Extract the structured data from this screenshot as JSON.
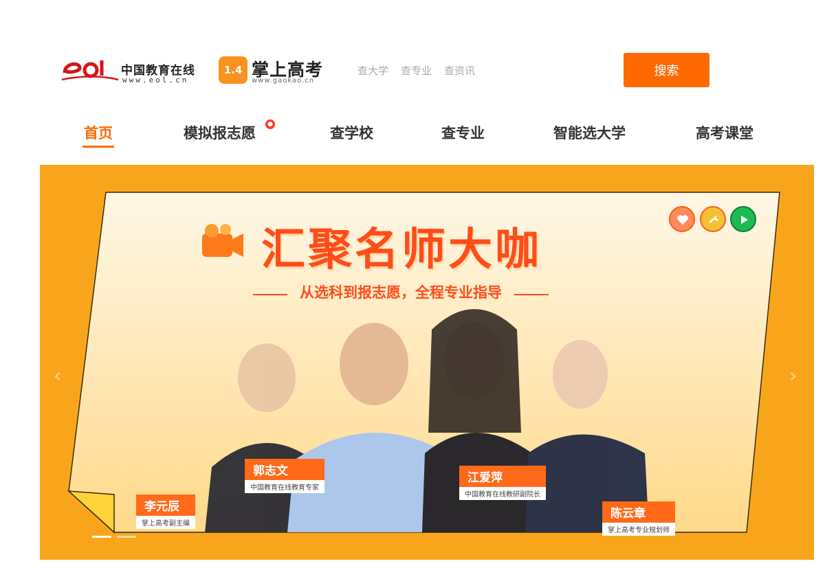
{
  "header": {
    "eol_logo": {
      "mark": "eoL",
      "name": "中国教育在线",
      "url": "www.eol.cn"
    },
    "gk_logo": {
      "badge": "1.4",
      "name": "掌上高考",
      "url": "www.gaokao.cn"
    },
    "search_links": [
      "查大学",
      "查专业",
      "查资讯"
    ],
    "search_button": "搜索"
  },
  "nav": {
    "items": [
      {
        "label": "首页",
        "active": true
      },
      {
        "label": "模拟报志愿",
        "badge": "fire-icon"
      },
      {
        "label": "查学校"
      },
      {
        "label": "查专业"
      },
      {
        "label": "智能选大学"
      },
      {
        "label": "高考课堂"
      }
    ]
  },
  "banner": {
    "title": "汇聚名师大咖",
    "subtitle": "从选科到报志愿，全程专业指导",
    "controls": [
      "heart-icon",
      "share-icon",
      "play-icon"
    ],
    "people": [
      {
        "name": "李元辰",
        "role": "掌上高考副主编"
      },
      {
        "name": "郭志文",
        "role": "中国教育在线教育专家"
      },
      {
        "name": "江爱萍",
        "role": "中国教育在线教研副院长"
      },
      {
        "name": "陈云章",
        "role": "掌上高考专业规划师"
      }
    ],
    "colors": {
      "accent": "#ff6a00",
      "banner_bg": "#f9a51c",
      "card_bg": "#ffeec8"
    }
  }
}
